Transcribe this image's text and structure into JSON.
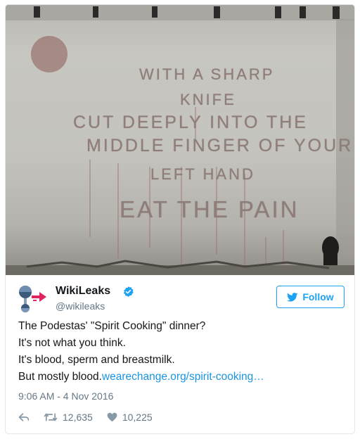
{
  "media": {
    "wall_text": [
      "WITH A SHARP",
      "KNIFE",
      "CUT DEEPLY INTO THE",
      "MIDDLE FINGER OF YOUR",
      "LEFT HAND",
      "EAT THE PAIN"
    ]
  },
  "account": {
    "name": "WikiLeaks",
    "handle": "@wikileaks"
  },
  "follow_label": "Follow",
  "tweet": {
    "lines": [
      "The Podestas' \"Spirit Cooking\" dinner?",
      "It's not what you think.",
      "It's blood, sperm and breastmilk."
    ],
    "last_line_prefix": "But mostly blood.",
    "link_text": "wearechange.org/spirit-cooking…"
  },
  "timestamp": "9:06 AM - 4 Nov 2016",
  "stats": {
    "retweets": "12,635",
    "likes": "10,225"
  },
  "colors": {
    "accent": "#1da1f2",
    "link": "#1b95e0",
    "muted": "#657786"
  }
}
